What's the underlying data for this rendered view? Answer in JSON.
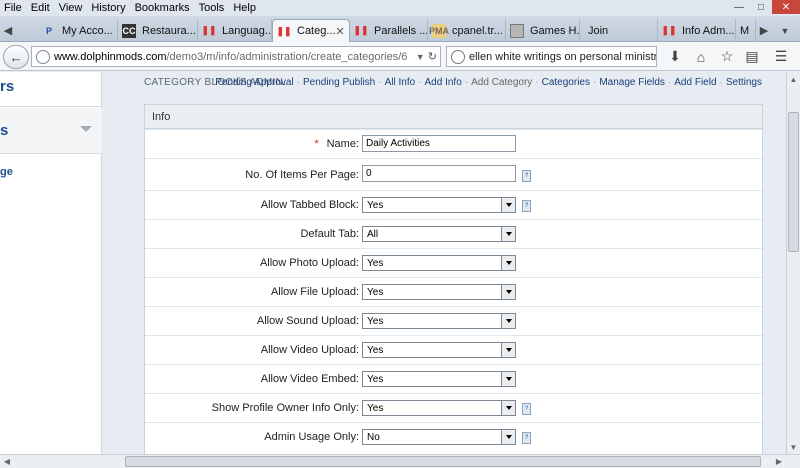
{
  "menu": [
    "File",
    "Edit",
    "View",
    "History",
    "Bookmarks",
    "Tools",
    "Help"
  ],
  "tabs": [
    {
      "label": "My Acco...",
      "icon": "paypal-icon"
    },
    {
      "label": "Restaura...",
      "icon": "cc-icon"
    },
    {
      "label": "Languag...",
      "icon": "parallels-icon"
    },
    {
      "label": "Categ...",
      "icon": "parallels-icon",
      "active": true
    },
    {
      "label": "Parallels ...",
      "icon": "parallels-icon"
    },
    {
      "label": "cpanel.tr...",
      "icon": "phpmyadmin-icon"
    },
    {
      "label": "Games H...",
      "icon": "image-icon"
    },
    {
      "label": "Join",
      "icon": ""
    },
    {
      "label": "Info Adm...",
      "icon": "parallels-icon"
    },
    {
      "label": "M",
      "icon": ""
    }
  ],
  "url": {
    "domain": "www.dolphinmods.com",
    "path": "/demo3/m/info/administration/create_categories/6"
  },
  "search": {
    "value": "ellen white writings on personal ministries"
  },
  "sidebar": {
    "title": "rs",
    "section_label": "s",
    "link": "ge"
  },
  "page": {
    "heading": "CATEGORY BLOCKS ADMIN.",
    "links": [
      {
        "label": "Pending Approval",
        "active": true
      },
      {
        "label": "Pending Publish",
        "active": true
      },
      {
        "label": "All Info",
        "active": true
      },
      {
        "label": "Add Info",
        "active": true
      },
      {
        "label": "Add Category",
        "active": false
      },
      {
        "label": "Categories",
        "active": true
      },
      {
        "label": "Manage Fields",
        "active": true
      },
      {
        "label": "Add Field",
        "active": true
      },
      {
        "label": "Settings",
        "active": true
      }
    ]
  },
  "form": {
    "header": "Info",
    "rows": [
      {
        "label": "Name:",
        "type": "text",
        "value": "Daily Activities",
        "required": true,
        "help": false
      },
      {
        "label": "No. Of Items Per Page:",
        "type": "text",
        "value": "0",
        "required": false,
        "help": true
      },
      {
        "label": "Allow Tabbed Block:",
        "type": "select",
        "value": "Yes",
        "required": false,
        "help": true
      },
      {
        "label": "Default Tab:",
        "type": "select",
        "value": "All",
        "required": false,
        "help": false
      },
      {
        "label": "Allow Photo Upload:",
        "type": "select",
        "value": "Yes",
        "required": false,
        "help": false
      },
      {
        "label": "Allow File Upload:",
        "type": "select",
        "value": "Yes",
        "required": false,
        "help": false
      },
      {
        "label": "Allow Sound Upload:",
        "type": "select",
        "value": "Yes",
        "required": false,
        "help": false
      },
      {
        "label": "Allow Video Upload:",
        "type": "select",
        "value": "Yes",
        "required": false,
        "help": false
      },
      {
        "label": "Allow Video Embed:",
        "type": "select",
        "value": "Yes",
        "required": false,
        "help": false
      },
      {
        "label": "Show Profile Owner Info Only:",
        "type": "select",
        "value": "Yes",
        "required": false,
        "help": true
      },
      {
        "label": "Admin Usage Only:",
        "type": "select",
        "value": "No",
        "required": false,
        "help": true
      }
    ],
    "help_glyph": "?"
  }
}
